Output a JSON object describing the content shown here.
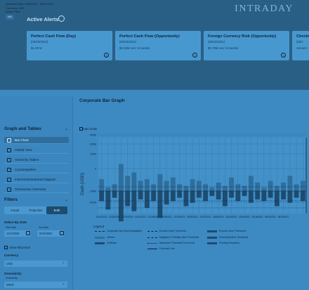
{
  "brand": "INTRADAY",
  "alerts": {
    "title": "Active Alerts",
    "cards": [
      {
        "title": "Perfect Cash Flow (Day)",
        "date": "(03/10/2022)",
        "value": "$1.29 M"
      },
      {
        "title": "Perfect Cash Flow (Opportunity)",
        "date": "(06/10/2021)",
        "value": "$4.04M over 13 weeks"
      },
      {
        "title": "Foreign Currency Risk (Opportunity)",
        "date": "(06/10/2021)",
        "value": "$5.75M over 13 weeks"
      },
      {
        "title": "Check/",
        "date": "(06/1",
        "value": "Amount"
      }
    ]
  },
  "sidebar": {
    "selected_date": "Selected Date: 6/30/2020 - 06/21/2021",
    "currency": "Currency: USD",
    "active_filter": "Active Filter:",
    "filter_chip": "N/A",
    "graphs_title": "Graph and Tables",
    "nav": [
      "Bar Chart",
      "Global View",
      "Hierarchy Tables",
      "Counterparties",
      "Interconnectedness Diagram",
      "Transaction Overview"
    ],
    "filters_title": "Filters",
    "segments": [
      "Actual",
      "Projection",
      "Both"
    ],
    "select_by_date": "Select By Date",
    "start_label": "Start Date",
    "end_label": "End Date",
    "start_value": "12/1/2020",
    "end_value": "8/31/2021",
    "show_full_period": "Show full period",
    "currency_label": "Currency",
    "currency_value": "USD",
    "granularity_label": "Granularity",
    "granularity_sub": "Granularity",
    "granularity_value": "Week"
  },
  "chart": {
    "title": "Corporate Bar Graph",
    "autoscale": "Auto Scale",
    "legend_title": "Legend",
    "legend": [
      "Corporate Net Cash Availability",
      "Excess Cash Threshold",
      "Excess Cash Threshold",
      "Inflows",
      "Negative & Positive Alert Threshold",
      "Exceeded Alert Threshold",
      "Outflows",
      "Maximum Threshold Trend Line",
      "Funding Required",
      "Forecast Line"
    ]
  },
  "chart_data": {
    "type": "bar",
    "ylabel": "Cash (USD)",
    "ylim": [
      -400000,
      400000
    ],
    "yticks": [
      "400M",
      "200M",
      "100M",
      "0",
      "-100M",
      "-200M"
    ],
    "categories": [
      "12/1/2020",
      "12/8/2020",
      "12/15/2020",
      "12/22/2020",
      "12/29/2020",
      "1/5/2021",
      "1/12/2021",
      "1/19/2021",
      "1/26/2021",
      "2/2/2021",
      "2/9/2021",
      "2/16/2021",
      "2/23/2021",
      "3/2/2021",
      "3/9/2021",
      "3/16/2021",
      "3/23/2021",
      "3/30/2021",
      "4/6/2021",
      "4/13/2021",
      "4/20/2021",
      "4/27/2021",
      "5/4/2021",
      "5/11/2021",
      "5/18/2021",
      "5/25/2021",
      "6/1/2021",
      "6/8/2021",
      "6/15/2021",
      "6/22/2021",
      "6/29/2021",
      "7/6/2021"
    ],
    "xtick_labels": [
      "12/01/2020",
      "12/15/2020",
      "12/29/2020",
      "01/12/2021",
      "01/26/2021",
      "02/09/2021",
      "02/23/2021",
      "03/09/2021",
      "03/23/2021",
      "04/06/2021",
      "04/20/2021",
      "05/04/2021",
      "05/18/2021",
      "06/01/2021",
      "06/15/2021"
    ],
    "series": [
      {
        "name": "Inflows",
        "values": [
          70,
          20,
          40,
          160,
          90,
          110,
          60,
          70,
          40,
          100,
          60,
          80,
          40,
          30,
          70,
          60,
          40,
          20,
          50,
          30,
          80,
          40,
          30,
          90,
          50,
          20,
          60,
          30,
          50,
          90,
          40,
          60
        ]
      },
      {
        "name": "Outflows",
        "values": [
          -60,
          -110,
          -40,
          -180,
          -90,
          -120,
          -50,
          -100,
          -60,
          -160,
          -80,
          -60,
          -40,
          -90,
          -70,
          -40,
          -60,
          -30,
          -50,
          -90,
          -40,
          -60,
          -30,
          -70,
          -50,
          -60,
          -40,
          -90,
          -50,
          -70,
          -40,
          -60
        ]
      }
    ],
    "colors": {
      "inflow": "#2f6e9c",
      "outflow": "#1d4c70",
      "positive_band": "#4a98cf"
    }
  }
}
